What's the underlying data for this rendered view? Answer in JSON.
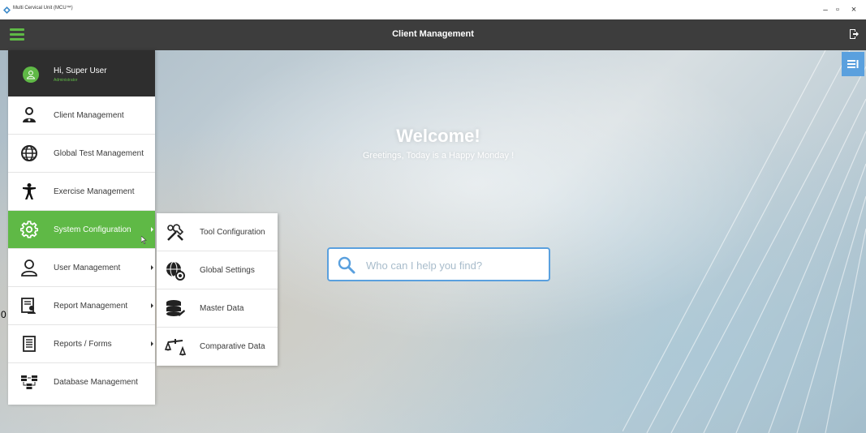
{
  "window": {
    "title": "Multi Cervical Unit (MCU™)",
    "minimize": "–",
    "maximize": "▫",
    "close": "×"
  },
  "header": {
    "title": "Client Management"
  },
  "hero": {
    "welcome": "Welcome!",
    "greeting": "Greetings, Today is a Happy Monday !"
  },
  "search": {
    "placeholder": "Who can I help you find?"
  },
  "user": {
    "name": "Hi, Super User",
    "role": "Administrator"
  },
  "sidebar": {
    "items": [
      {
        "label": "Client Management",
        "icon": "client-icon",
        "has_submenu": false,
        "active": false
      },
      {
        "label": "Global Test Management",
        "icon": "globe-icon",
        "has_submenu": false,
        "active": false
      },
      {
        "label": "Exercise Management",
        "icon": "exercise-icon",
        "has_submenu": false,
        "active": false
      },
      {
        "label": "System Configuration",
        "icon": "gear-icon",
        "has_submenu": true,
        "active": true
      },
      {
        "label": "User Management",
        "icon": "user-icon",
        "has_submenu": true,
        "active": false
      },
      {
        "label": "Report Management",
        "icon": "report-icon",
        "has_submenu": true,
        "active": false
      },
      {
        "label": "Reports / Forms",
        "icon": "document-icon",
        "has_submenu": true,
        "active": false
      },
      {
        "label": "Database Management",
        "icon": "database-icon",
        "has_submenu": false,
        "active": false
      }
    ]
  },
  "submenu": {
    "items": [
      {
        "label": "Tool Configuration",
        "icon": "tools-icon"
      },
      {
        "label": "Global Settings",
        "icon": "globe-settings-icon"
      },
      {
        "label": "Master Data",
        "icon": "master-data-icon"
      },
      {
        "label": "Comparative Data",
        "icon": "scales-icon"
      }
    ]
  },
  "stray_text": "0",
  "colors": {
    "accent_green": "#5fb946",
    "header_dark": "#3d3d3d",
    "user_card": "#2e2e2e",
    "search_border": "#5aa0de"
  }
}
